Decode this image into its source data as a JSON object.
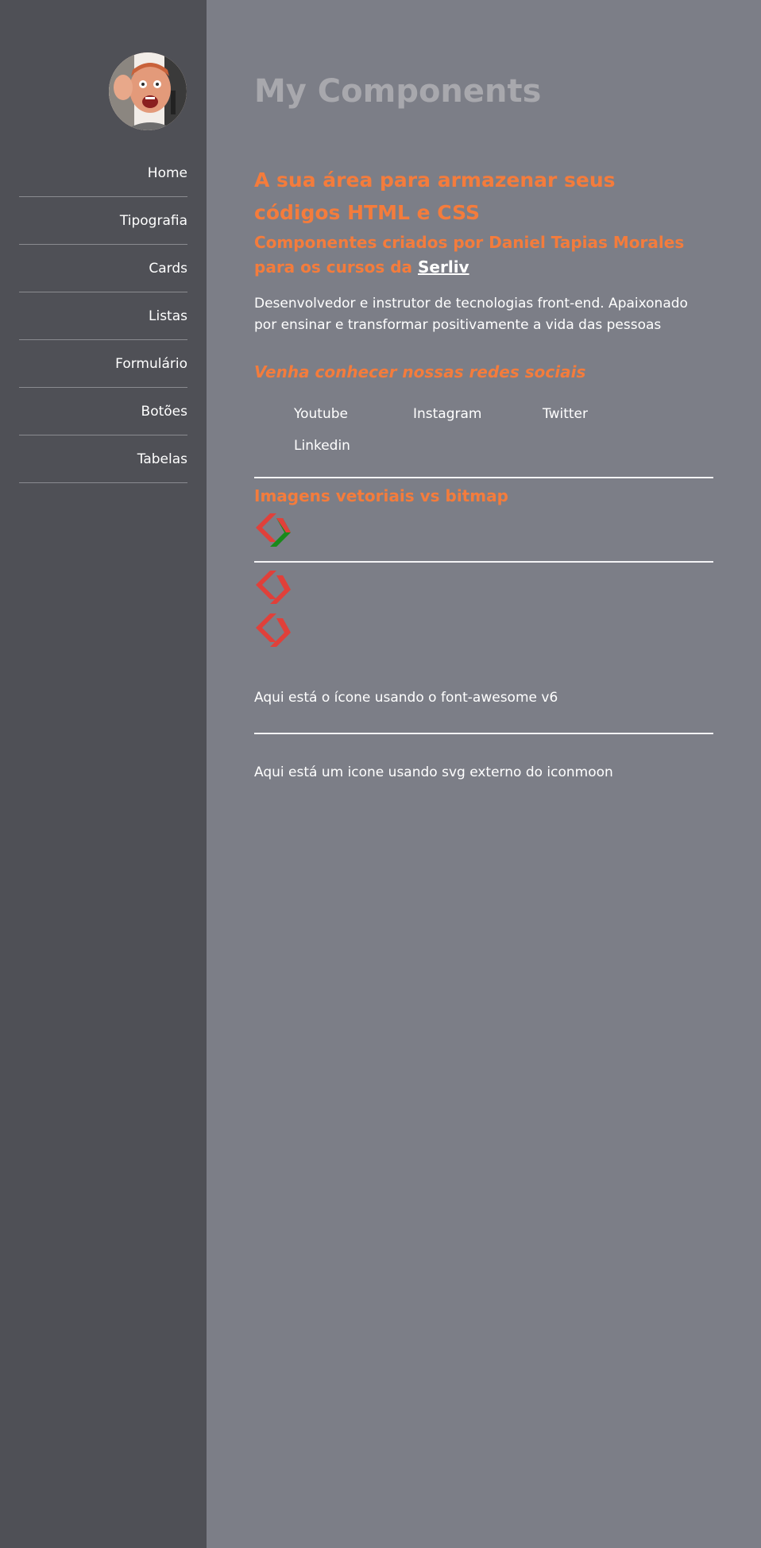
{
  "sidebar": {
    "avatar_alt": "Daniel Tapias Morales",
    "nav": [
      {
        "label": "Home"
      },
      {
        "label": "Tipografia"
      },
      {
        "label": "Cards"
      },
      {
        "label": "Listas"
      },
      {
        "label": "Formulário"
      },
      {
        "label": "Botões"
      },
      {
        "label": "Tabelas"
      }
    ]
  },
  "main": {
    "title": "My Components",
    "headline": "A sua área para armazenar seus códigos HTML e CSS",
    "subheadline_prefix": "Componentes criados por Daniel Tapias Morales para os cursos da ",
    "subheadline_link": "Serliv",
    "description": "Desenvolvedor e instrutor de tecnologias front-end. Apaixonado por ensinar e transformar positivamente a vida das pessoas",
    "social_title": "Venha conhecer nossas redes sociais",
    "social_links": [
      {
        "label": "Youtube"
      },
      {
        "label": "Instagram"
      },
      {
        "label": "Twitter"
      },
      {
        "label": "Linkedin"
      }
    ],
    "vector_title": "Imagens vetoriais vs bitmap",
    "fontawesome_text": "Aqui está o ícone usando o font-awesome v6",
    "iconmoon_text": "Aqui está um icone usando svg externo do iconmoon"
  },
  "colors": {
    "sidebar_bg": "#4f5056",
    "main_bg": "#7c7e87",
    "accent": "#f47c3c",
    "title_gray": "#a8a8ad",
    "logo_red": "#e0403a",
    "logo_green": "#1a8a1a"
  },
  "icons": [
    "serliv-logo-icon"
  ]
}
